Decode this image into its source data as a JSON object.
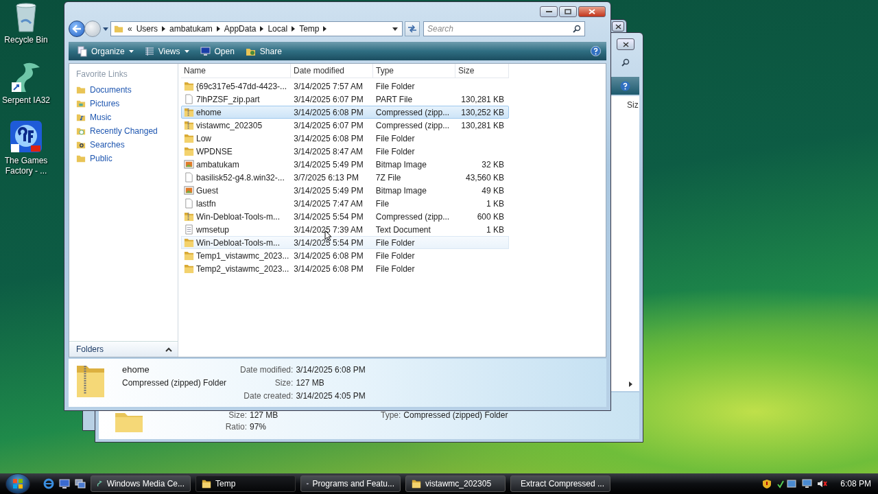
{
  "desktop_icons": [
    {
      "label": "Recycle Bin"
    },
    {
      "label": "Serpent IA32"
    },
    {
      "label": "The Games Factory - ..."
    }
  ],
  "back_window": {
    "column_header": "Siz",
    "details": [
      {
        "label": "Size:",
        "value": "127 MB"
      },
      {
        "label": "Ratio:",
        "value": "97%"
      },
      {
        "label": "Type:",
        "value": "Compressed (zipped) Folder"
      }
    ]
  },
  "window": {
    "address": {
      "overflow": "«",
      "crumbs": [
        "Users",
        "ambatukam",
        "AppData",
        "Local",
        "Temp"
      ]
    },
    "search": {
      "placeholder": "Search"
    },
    "toolbar": [
      {
        "label": "Organize",
        "kind": "menu"
      },
      {
        "label": "Views",
        "kind": "menu"
      },
      {
        "label": "Open",
        "kind": "button"
      },
      {
        "label": "Share",
        "kind": "button"
      }
    ],
    "sidebar": {
      "title": "Favorite Links",
      "items": [
        {
          "label": "Documents"
        },
        {
          "label": "Pictures"
        },
        {
          "label": "Music"
        },
        {
          "label": "Recently Changed"
        },
        {
          "label": "Searches"
        },
        {
          "label": "Public"
        }
      ],
      "folders_label": "Folders"
    },
    "columns": [
      "Name",
      "Date modified",
      "Type",
      "Size"
    ],
    "rows": [
      {
        "name": "{69c317e5-47dd-4423-...",
        "date": "3/14/2025 7:57 AM",
        "type": "File Folder",
        "size": "",
        "kind": "folder",
        "selected": false,
        "hovered": false
      },
      {
        "name": "7lhPZSF_zip.part",
        "date": "3/14/2025 6:07 PM",
        "type": "PART File",
        "size": "130,281 KB",
        "kind": "file",
        "selected": false,
        "hovered": false
      },
      {
        "name": "ehome",
        "date": "3/14/2025 6:08 PM",
        "type": "Compressed (zipp...",
        "size": "130,252 KB",
        "kind": "zip",
        "selected": true,
        "hovered": false
      },
      {
        "name": "vistawmc_202305",
        "date": "3/14/2025 6:07 PM",
        "type": "Compressed (zipp...",
        "size": "130,281 KB",
        "kind": "zip",
        "selected": false,
        "hovered": false
      },
      {
        "name": "Low",
        "date": "3/14/2025 6:08 PM",
        "type": "File Folder",
        "size": "",
        "kind": "folder",
        "selected": false,
        "hovered": false
      },
      {
        "name": "WPDNSE",
        "date": "3/14/2025 8:47 AM",
        "type": "File Folder",
        "size": "",
        "kind": "folder",
        "selected": false,
        "hovered": false
      },
      {
        "name": "ambatukam",
        "date": "3/14/2025 5:49 PM",
        "type": "Bitmap Image",
        "size": "32 KB",
        "kind": "image",
        "selected": false,
        "hovered": false
      },
      {
        "name": "basilisk52-g4.8.win32-...",
        "date": "3/7/2025 6:13 PM",
        "type": "7Z File",
        "size": "43,560 KB",
        "kind": "file",
        "selected": false,
        "hovered": false
      },
      {
        "name": "Guest",
        "date": "3/14/2025 5:49 PM",
        "type": "Bitmap Image",
        "size": "49 KB",
        "kind": "image",
        "selected": false,
        "hovered": false
      },
      {
        "name": "lastfn",
        "date": "3/14/2025 7:47 AM",
        "type": "File",
        "size": "1 KB",
        "kind": "file",
        "selected": false,
        "hovered": false
      },
      {
        "name": "Win-Debloat-Tools-m...",
        "date": "3/14/2025 5:54 PM",
        "type": "Compressed (zipp...",
        "size": "600 KB",
        "kind": "zip",
        "selected": false,
        "hovered": false
      },
      {
        "name": "wmsetup",
        "date": "3/14/2025 7:39 AM",
        "type": "Text Document",
        "size": "1 KB",
        "kind": "text",
        "selected": false,
        "hovered": false
      },
      {
        "name": "Win-Debloat-Tools-m...",
        "date": "3/14/2025 5:54 PM",
        "type": "File Folder",
        "size": "",
        "kind": "folder",
        "selected": false,
        "hovered": true
      },
      {
        "name": "Temp1_vistawmc_2023...",
        "date": "3/14/2025 6:08 PM",
        "type": "File Folder",
        "size": "",
        "kind": "folder",
        "selected": false,
        "hovered": false
      },
      {
        "name": "Temp2_vistawmc_2023...",
        "date": "3/14/2025 6:08 PM",
        "type": "File Folder",
        "size": "",
        "kind": "folder",
        "selected": false,
        "hovered": false
      }
    ],
    "details": {
      "name": "ehome",
      "type": "Compressed (zipped) Folder",
      "fields": [
        {
          "label": "Date modified:",
          "value": "3/14/2025 6:08 PM"
        },
        {
          "label": "Size:",
          "value": "127 MB"
        },
        {
          "label": "Date created:",
          "value": "3/14/2025 4:05 PM"
        }
      ]
    }
  },
  "taskbar": {
    "buttons": [
      {
        "label": "Windows Media Ce...",
        "selected": false
      },
      {
        "label": "Temp",
        "selected": true
      },
      {
        "label": "Programs and Featu...",
        "selected": false
      },
      {
        "label": "vistawmc_202305",
        "selected": false
      },
      {
        "label": "Extract Compressed ...",
        "selected": false
      }
    ],
    "clock": "6:08 PM"
  }
}
